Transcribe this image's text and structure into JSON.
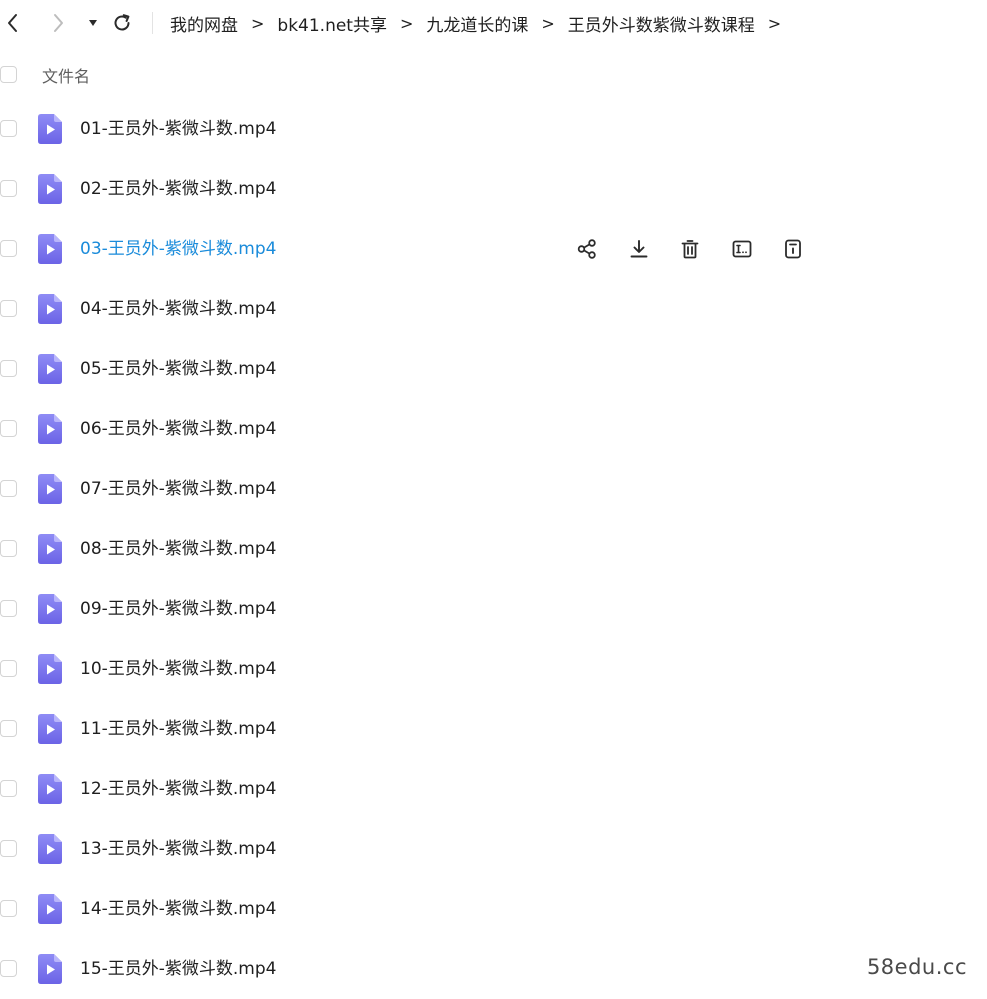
{
  "toolbar": {
    "back_icon": "chevron-left-icon",
    "forward_icon": "chevron-right-icon",
    "history_dropdown_icon": "caret-down-icon",
    "refresh_icon": "refresh-icon"
  },
  "breadcrumb": {
    "items": [
      "我的网盘",
      "bk41.net共享",
      "九龙道长的课",
      "王员外斗数紫微斗数课程"
    ],
    "separator": ">"
  },
  "list_header": {
    "name_column": "文件名"
  },
  "files": [
    {
      "name": "01-王员外-紫微斗数.mp4"
    },
    {
      "name": "02-王员外-紫微斗数.mp4"
    },
    {
      "name": "03-王员外-紫微斗数.mp4"
    },
    {
      "name": "04-王员外-紫微斗数.mp4"
    },
    {
      "name": "05-王员外-紫微斗数.mp4"
    },
    {
      "name": "06-王员外-紫微斗数.mp4"
    },
    {
      "name": "07-王员外-紫微斗数.mp4"
    },
    {
      "name": "08-王员外-紫微斗数.mp4"
    },
    {
      "name": "09-王员外-紫微斗数.mp4"
    },
    {
      "name": "10-王员外-紫微斗数.mp4"
    },
    {
      "name": "11-王员外-紫微斗数.mp4"
    },
    {
      "name": "12-王员外-紫微斗数.mp4"
    },
    {
      "name": "13-王员外-紫微斗数.mp4"
    },
    {
      "name": "14-王员外-紫微斗数.mp4"
    },
    {
      "name": "15-王员外-紫微斗数.mp4"
    }
  ],
  "hovered_row": 2,
  "row_actions": [
    "share-icon",
    "download-icon",
    "delete-icon",
    "rename-icon",
    "details-icon"
  ],
  "colors": {
    "hover_link": "#1a8bda",
    "video_icon_top": "#8f8cf5",
    "video_icon_bottom": "#6b63e6"
  },
  "watermark": "58edu.cc"
}
